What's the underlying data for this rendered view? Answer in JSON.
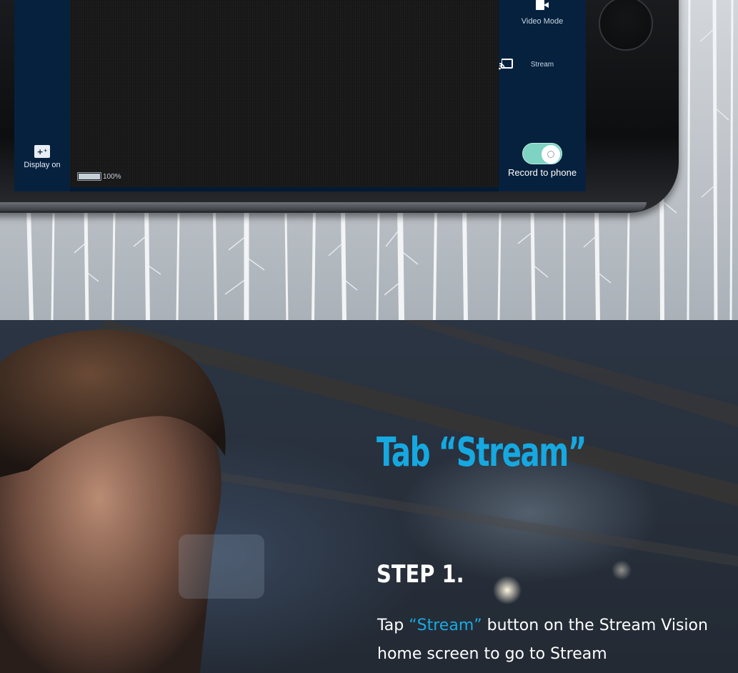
{
  "app": {
    "display_label": "Display on",
    "display_icon": "display-brightness-icon",
    "battery_text": "100%",
    "video_mode_label": "Video Mode",
    "video_icon": "video-camera-icon",
    "stream_label": "Stream",
    "stream_icon": "cast-icon",
    "record_label": "Record to phone",
    "record_toggle_state": "on"
  },
  "instructions": {
    "heading": "Tab “Stream”",
    "step_title": "STEP 1.",
    "text_before": "Tap ",
    "text_highlight": "“Stream”",
    "text_after": " button on the Stream Vision home screen to go to Stream"
  },
  "colors": {
    "accent_blue": "#16a8e0",
    "toggle_on": "#7ed3c3",
    "app_panel": "#06213e"
  }
}
